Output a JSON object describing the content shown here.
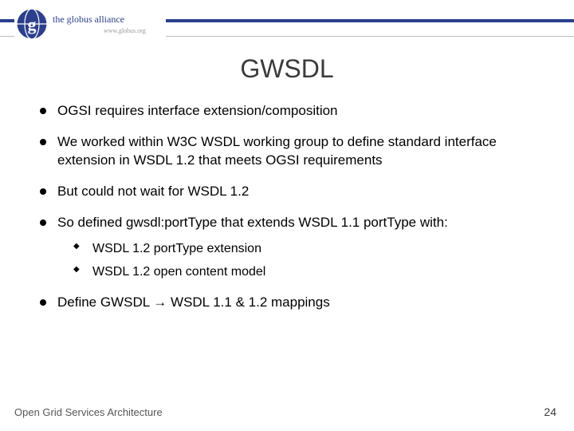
{
  "header": {
    "logo_main": "the globus alliance",
    "logo_sub": "www.globus.org"
  },
  "title": "GWSDL",
  "bullets": [
    {
      "text": "OGSI requires interface extension/composition"
    },
    {
      "text": "We worked within W3C WSDL working group to define standard interface extension in WSDL 1.2 that meets OGSI requirements"
    },
    {
      "text": "But could not wait for WSDL 1.2"
    },
    {
      "text": "So defined gwsdl:portType that extends WSDL 1.1 portType with:",
      "sub": [
        "WSDL 1.2 portType extension",
        "WSDL 1.2 open content model"
      ]
    },
    {
      "text": "Define GWSDL → WSDL 1.1 & 1.2 mappings"
    }
  ],
  "footer": {
    "left": "Open Grid Services Architecture",
    "page": "24"
  }
}
